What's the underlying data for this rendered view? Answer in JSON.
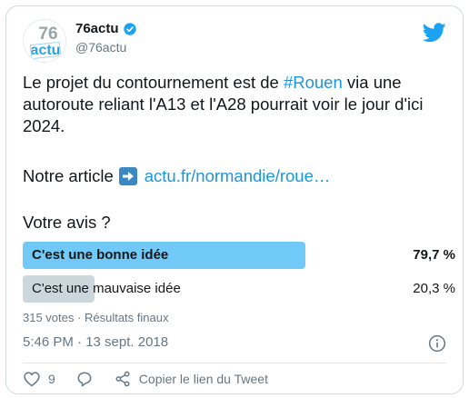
{
  "account": {
    "display_name": "76actu",
    "handle": "@76actu",
    "avatar_text_top": "76",
    "avatar_text_bottom": "actu",
    "verified": true
  },
  "tweet": {
    "text_before": "Le projet du contournement est de ",
    "hashtag": "#Rouen",
    "text_after": " via une autoroute reliant l'A13 et l'A28 pourrait voir le jour d'ici 2024.",
    "article_prefix": "Notre article",
    "article_link": "actu.fr/normandie/roue…",
    "question": "Votre avis ?"
  },
  "poll": {
    "options": [
      {
        "label": "C'est une bonne idée",
        "percent_text": "79,7 %",
        "percent": 79.7,
        "winner": true
      },
      {
        "label": "C'est une mauvaise idée",
        "percent_text": "20,3 %",
        "percent": 20.3,
        "winner": false
      }
    ],
    "votes": "315 votes",
    "separator": "·",
    "status": "Résultats finaux"
  },
  "timestamp": "5:46 PM · 13 sept. 2018",
  "actions": {
    "likes": "9",
    "copy_link": "Copier le lien du Tweet"
  },
  "colors": {
    "link": "#1b95e0",
    "poll_winner": "#71c9f8",
    "poll_other": "#ccd6dd",
    "verified": "#1da1f2",
    "twitter": "#1da1f2"
  },
  "icons": [
    "verified-icon",
    "twitter-icon",
    "arrow-right-icon",
    "info-icon",
    "heart-icon",
    "reply-icon",
    "share-icon"
  ]
}
